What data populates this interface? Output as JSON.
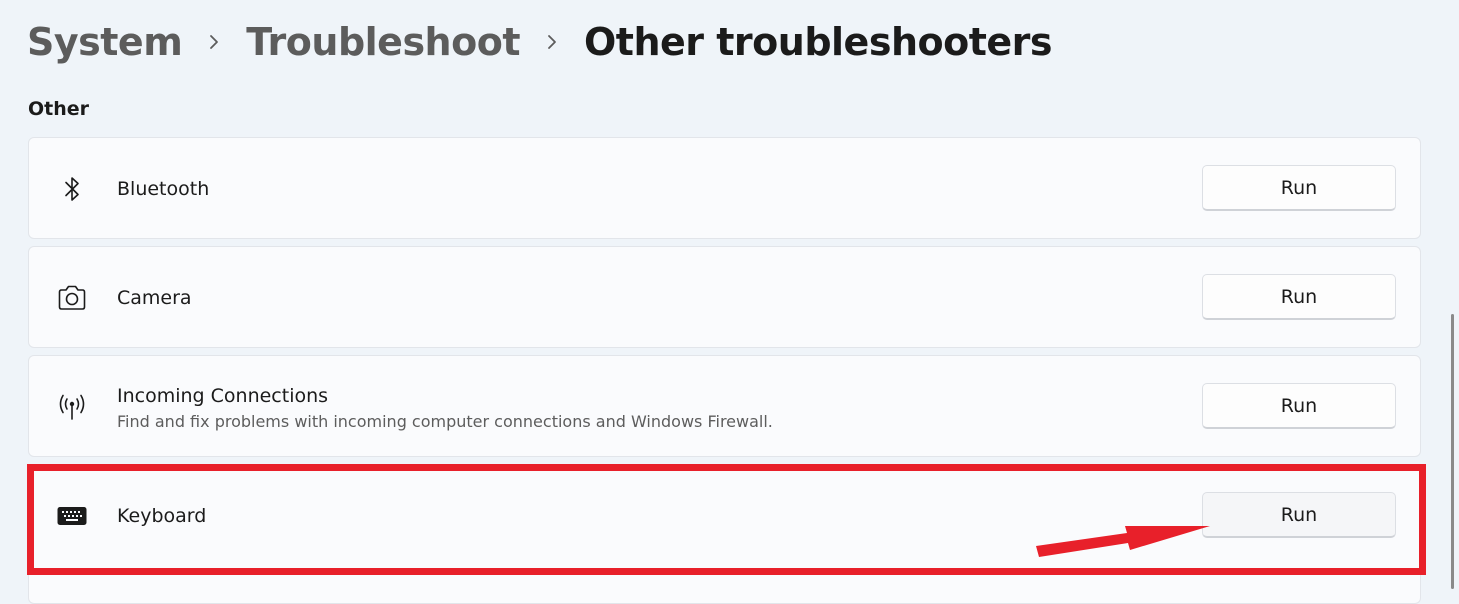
{
  "breadcrumb": {
    "items": [
      "System",
      "Troubleshoot"
    ],
    "current": "Other troubleshooters"
  },
  "section": {
    "title": "Other"
  },
  "troubleshooters": [
    {
      "title": "Bluetooth",
      "icon": "bluetooth-icon",
      "button": "Run"
    },
    {
      "title": "Camera",
      "icon": "camera-icon",
      "button": "Run"
    },
    {
      "title": "Incoming Connections",
      "description": "Find and fix problems with incoming computer connections and Windows Firewall.",
      "icon": "incoming-connections-icon",
      "button": "Run"
    },
    {
      "title": "Keyboard",
      "icon": "keyboard-icon",
      "button": "Run"
    }
  ],
  "annotation": {
    "highlight_color": "#e8202a",
    "highlighted_item": "Keyboard"
  }
}
